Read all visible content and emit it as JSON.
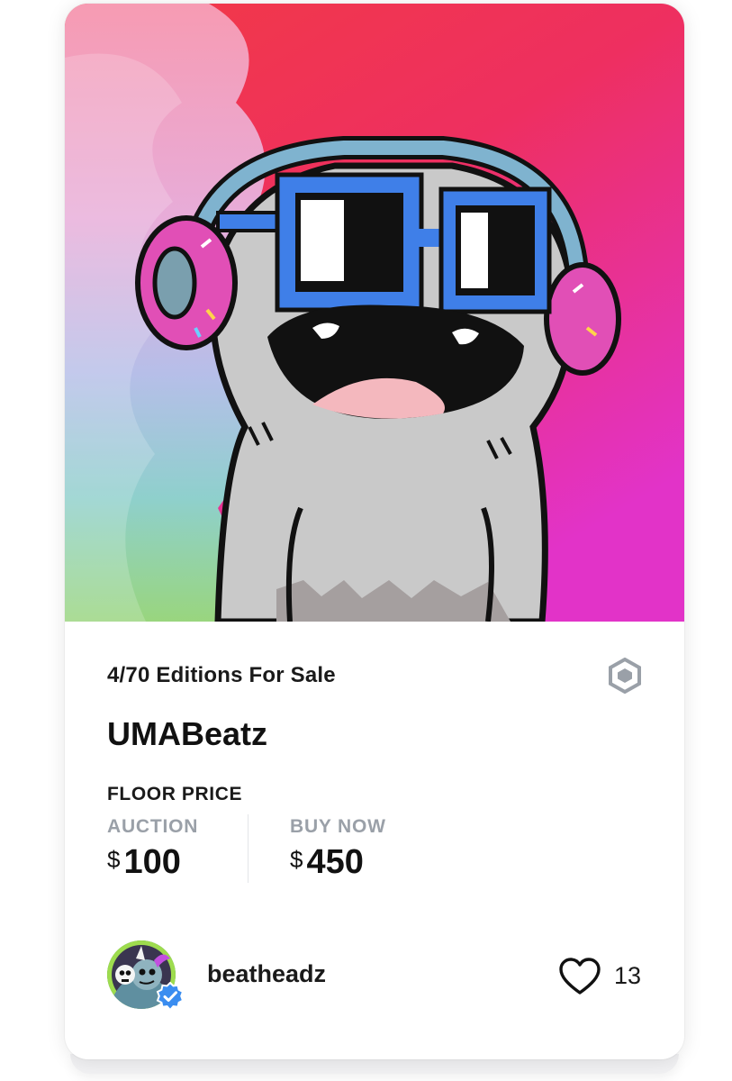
{
  "card": {
    "artwork": {
      "alt": "UMABeatz artwork",
      "colors": {
        "bg_top": "#ee3340",
        "bg_bottom": "#e035c9",
        "character": "#c8c8c8",
        "glasses": "#3f7fe8",
        "headphones": "#e14fb6"
      }
    },
    "editions_text": "4/70 Editions For Sale",
    "chain_icon": "hexagon-icon",
    "title": "UMABeatz",
    "floor_price_label": "FLOOR PRICE",
    "auction": {
      "label": "AUCTION",
      "currency": "$",
      "amount": "100"
    },
    "buy_now": {
      "label": "BUY NOW",
      "currency": "$",
      "amount": "450"
    },
    "creator": {
      "name": "beatheadz",
      "verified_icon": "verified-badge-icon"
    },
    "likes": {
      "icon": "heart-icon",
      "count": "13"
    },
    "colors": {
      "muted": "#9aa0a8",
      "verified": "#3a8df0",
      "text": "#111111"
    }
  }
}
